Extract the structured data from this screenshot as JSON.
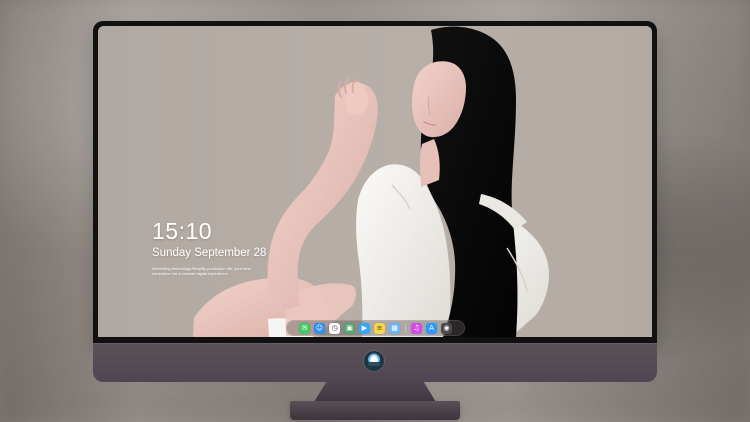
{
  "lock_screen": {
    "time": "15:10",
    "date": "Sunday September 28",
    "note": "Interesting technology.Simplify production life, your best companion for a smarter digital experience"
  },
  "dock": {
    "items": [
      {
        "name": "messages",
        "glyph": "✉",
        "bg": "#43c865"
      },
      {
        "name": "finder",
        "glyph": "☺",
        "bg": "#2e8ff2"
      },
      {
        "name": "clock",
        "glyph": "◷",
        "bg": "#ffffff"
      },
      {
        "name": "preview",
        "glyph": "▣",
        "bg": "#55a76e"
      },
      {
        "name": "video",
        "glyph": "▶",
        "bg": "#36a6ff"
      },
      {
        "name": "notes",
        "glyph": "≡",
        "bg": "#f4d64e"
      },
      {
        "name": "photos",
        "glyph": "▦",
        "bg": "#69b6f2"
      },
      {
        "name": "music",
        "glyph": "♫",
        "bg": "#d64be8"
      },
      {
        "name": "app-store",
        "glyph": "A",
        "bg": "#2f98ff"
      },
      {
        "name": "camera",
        "glyph": "◉",
        "bg": "#4a4a4a"
      }
    ]
  },
  "monitor": {
    "chin_logo": "computer-logo-icon",
    "colors": {
      "bezel": "#111111",
      "chin": "#5b5158",
      "stand": "#3f3842"
    }
  }
}
